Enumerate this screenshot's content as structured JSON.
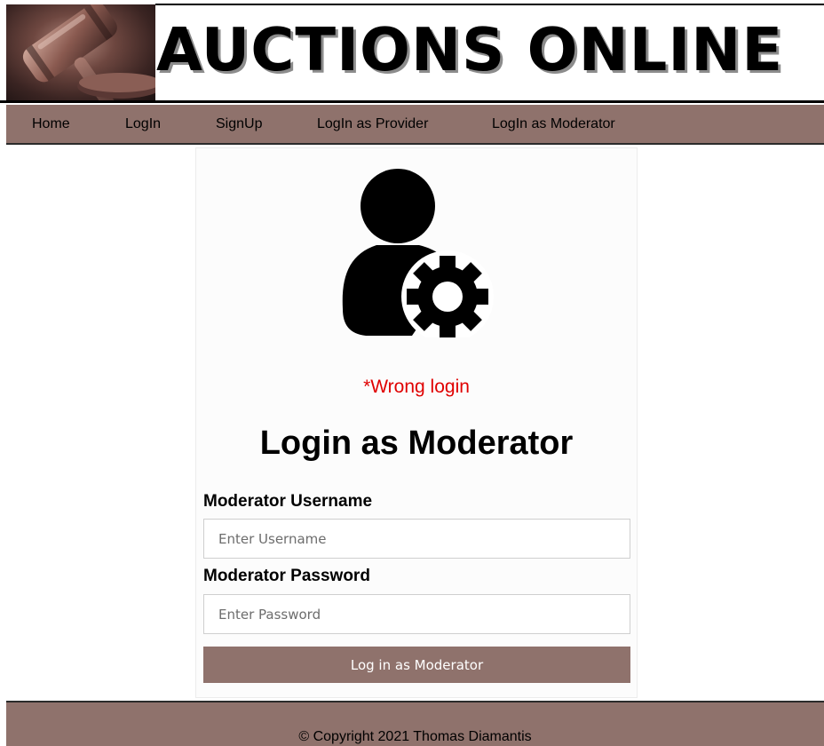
{
  "header": {
    "brand_title": "AUCTIONS ONLINE",
    "logo_icon": "gavel-icon"
  },
  "nav": {
    "items": [
      {
        "label": "Home"
      },
      {
        "label": "LogIn"
      },
      {
        "label": "SignUp"
      },
      {
        "label": "LogIn as Provider"
      },
      {
        "label": "LogIn as Moderator"
      }
    ]
  },
  "login": {
    "avatar_icon": "user-gear-icon",
    "error": "*Wrong login",
    "title": "Login as Moderator",
    "username_label": "Moderator Username",
    "username_placeholder": "Enter Username",
    "password_label": "Moderator Password",
    "password_placeholder": "Enter Password",
    "submit_label": "Log in as Moderator"
  },
  "footer": {
    "copyright": "© Copyright 2021 Thomas Diamantis"
  },
  "colors": {
    "nav_background": "#8f726c",
    "error_text": "#e00000",
    "button_text": "#ffffff"
  }
}
